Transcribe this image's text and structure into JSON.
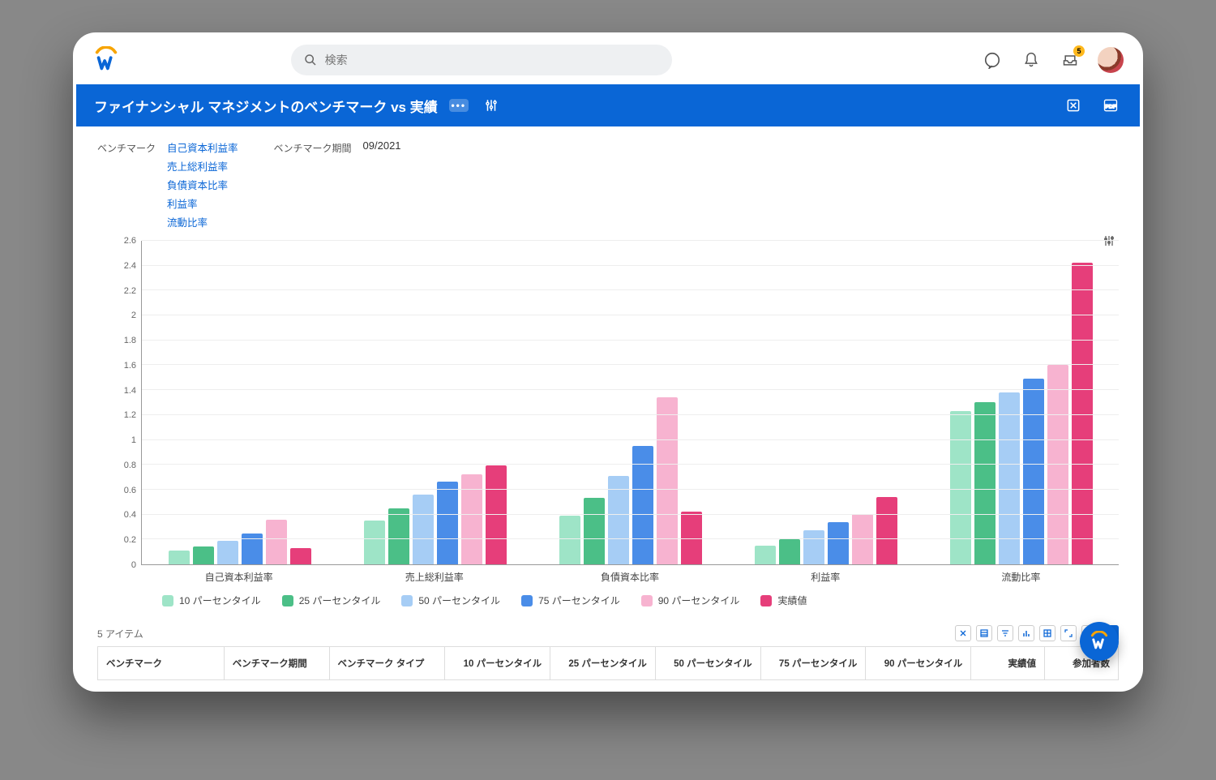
{
  "search": {
    "placeholder": "検索"
  },
  "tray_badge": "5",
  "titlebar": {
    "title": "ファイナンシャル マネジメントのベンチマーク vs 実績",
    "more": "•••"
  },
  "filters": {
    "benchmark_label": "ベンチマーク",
    "benchmark_links": [
      "自己資本利益率",
      "売上総利益率",
      "負債資本比率",
      "利益率",
      "流動比率"
    ],
    "period_label": "ベンチマーク期間",
    "period_value": "09/2021"
  },
  "chart_data": {
    "type": "bar",
    "ylim": [
      0,
      2.6
    ],
    "yticks": [
      0,
      0.2,
      0.4,
      0.6,
      0.8,
      1,
      1.2,
      1.4,
      1.6,
      1.8,
      2,
      2.2,
      2.4,
      2.6
    ],
    "categories": [
      "自己資本利益率",
      "売上総利益率",
      "負債資本比率",
      "利益率",
      "流動比率"
    ],
    "series": [
      {
        "name": "10 パーセンタイル",
        "color": "#9ee4c7",
        "values": [
          0.11,
          0.35,
          0.39,
          0.15,
          1.23
        ]
      },
      {
        "name": "25 パーセンタイル",
        "color": "#4bbf87",
        "values": [
          0.14,
          0.45,
          0.53,
          0.2,
          1.3
        ]
      },
      {
        "name": "50 パーセンタイル",
        "color": "#a6cdf5",
        "values": [
          0.19,
          0.56,
          0.71,
          0.27,
          1.38
        ]
      },
      {
        "name": "75 パーセンタイル",
        "color": "#4a8de8",
        "values": [
          0.25,
          0.66,
          0.95,
          0.34,
          1.49
        ]
      },
      {
        "name": "90 パーセンタイル",
        "color": "#f7b3d0",
        "values": [
          0.36,
          0.72,
          1.34,
          0.4,
          1.6
        ]
      },
      {
        "name": "実績値",
        "color": "#e63e7a",
        "values": [
          0.13,
          0.79,
          0.42,
          0.54,
          2.42
        ]
      }
    ]
  },
  "table": {
    "count_text": "5 アイテム",
    "headers": [
      "ベンチマーク",
      "ベンチマーク期間",
      "ベンチマーク タイプ",
      "10 パーセンタイル",
      "25 パーセンタイル",
      "50 パーセンタイル",
      "75 パーセンタイル",
      "90 パーセンタイル",
      "実績値",
      "参加者数"
    ]
  }
}
